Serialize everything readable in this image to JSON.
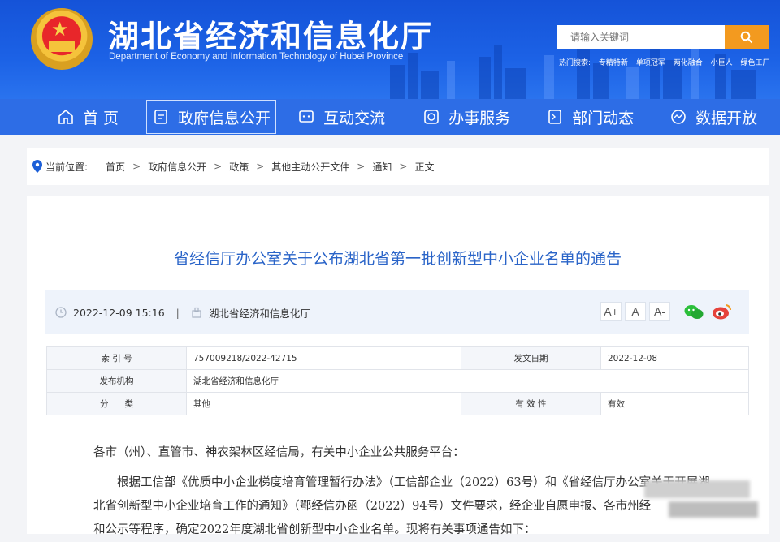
{
  "header": {
    "title": "湖北省经济和信息化厅",
    "subtitle": "Department of Economy and Information Technology of Hubei Province",
    "search_placeholder": "请输入关键词",
    "hot_label": "热门搜索:",
    "hot_items": [
      "专精特新",
      "单项冠军",
      "两化融合",
      "小巨人",
      "绿色工厂"
    ]
  },
  "nav": [
    {
      "label": "首 页",
      "icon": "home-icon"
    },
    {
      "label": "政府信息公开",
      "icon": "document-icon"
    },
    {
      "label": "互动交流",
      "icon": "chat-icon"
    },
    {
      "label": "办事服务",
      "icon": "service-icon"
    },
    {
      "label": "部门动态",
      "icon": "news-icon"
    },
    {
      "label": "数据开放",
      "icon": "data-icon"
    }
  ],
  "breadcrumb": {
    "label": "当前位置:",
    "items": [
      "首页",
      "政府信息公开",
      "政策",
      "其他主动公开文件",
      "通知",
      "正文"
    ]
  },
  "article": {
    "title": "省经信厅办公室关于公布湖北省第一批创新型中小企业名单的通告",
    "datetime": "2022-12-09 15:16",
    "source": "湖北省经济和信息化厅",
    "font_buttons": [
      "A+",
      "A",
      "A-"
    ]
  },
  "info_table": {
    "rows": [
      [
        "索 引 号",
        "757009218/2022-42715",
        "发文日期",
        "2022-12-08"
      ],
      [
        "发布机构",
        "湖北省经济和信息化厅",
        "",
        ""
      ],
      [
        "分      类",
        "其他",
        "有 效 性",
        "有效"
      ]
    ]
  },
  "body": {
    "greeting": "各市（州）、直管市、神农架林区经信局，有关中小企业公共服务平台：",
    "para1_line1": "根据工信部《优质中小企业梯度培育管理暂行办法》（工信部企业（2022）63号）和《省经信厅办公室关于开展湖",
    "para1_line2": "北省创新型中小企业培育工作的通知》（鄂经信办函（2022）94号）文件要求，经企业自愿申报、各市州经",
    "para1_line3": "和公示等程序，确定2022年度湖北省创新型中小企业名单。现将有关事项通告如下："
  },
  "colors": {
    "header_blue": "#1c62e6",
    "nav_blue": "#2d6de6",
    "title_blue": "#2a64c8",
    "search_orange": "#f39a1f"
  }
}
